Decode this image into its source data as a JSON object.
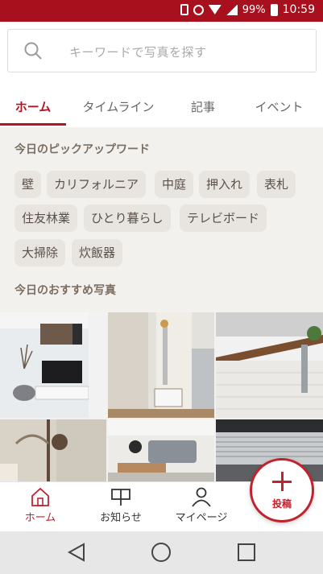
{
  "status_bar": {
    "battery": "99%",
    "time": "10:59"
  },
  "search": {
    "placeholder": "キーワードで写真を探す"
  },
  "tabs": [
    {
      "label": "ホーム",
      "active": true
    },
    {
      "label": "タイムライン",
      "active": false
    },
    {
      "label": "記事",
      "active": false
    },
    {
      "label": "イベント",
      "active": false
    }
  ],
  "pickup": {
    "title": "今日のピックアップワード",
    "words": [
      "壁",
      "カリフォルニア",
      "中庭",
      "押入れ",
      "表札",
      "住友林業",
      "ひとり暮らし",
      "テレビボード",
      "大掃除",
      "炊飯器"
    ]
  },
  "recommend": {
    "title": "今日のおすすめ写真"
  },
  "bottom_nav": {
    "home": "ホーム",
    "notifications": "お知らせ",
    "mypage": "マイページ",
    "post": "投稿"
  },
  "colors": {
    "brand": "#b11422",
    "accent": "#c2222e",
    "chip_bg": "#e8e4df"
  }
}
